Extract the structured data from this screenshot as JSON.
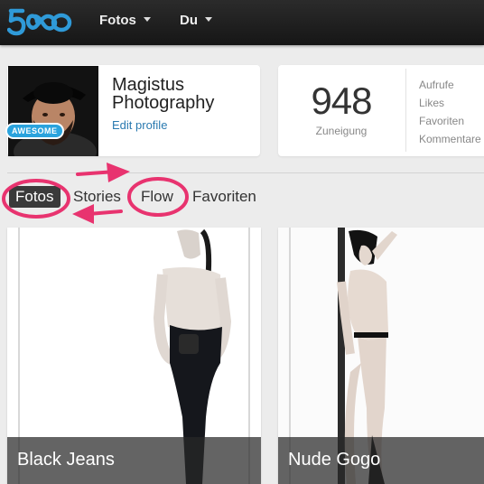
{
  "header": {
    "logo_text": "500",
    "nav": [
      {
        "label": "Fotos"
      },
      {
        "label": "Du"
      }
    ]
  },
  "profile": {
    "badge": "AWESOME",
    "name": "Magistus Photography",
    "edit_label": "Edit profile"
  },
  "stats": {
    "number": "948",
    "label": "Zuneigung",
    "items": [
      "Aufrufe",
      "Likes",
      "Favoriten",
      "Kommentare"
    ]
  },
  "tabs": [
    {
      "label": "Fotos",
      "active": true
    },
    {
      "label": "Stories"
    },
    {
      "label": "Flow"
    },
    {
      "label": "Favoriten"
    }
  ],
  "photos": [
    {
      "title": "Black Jeans"
    },
    {
      "title": "Nude Gogo"
    }
  ],
  "colors": {
    "accent": "#2f9ad8",
    "annotation": "#e8336f",
    "topbar": "#1c1c1c"
  }
}
